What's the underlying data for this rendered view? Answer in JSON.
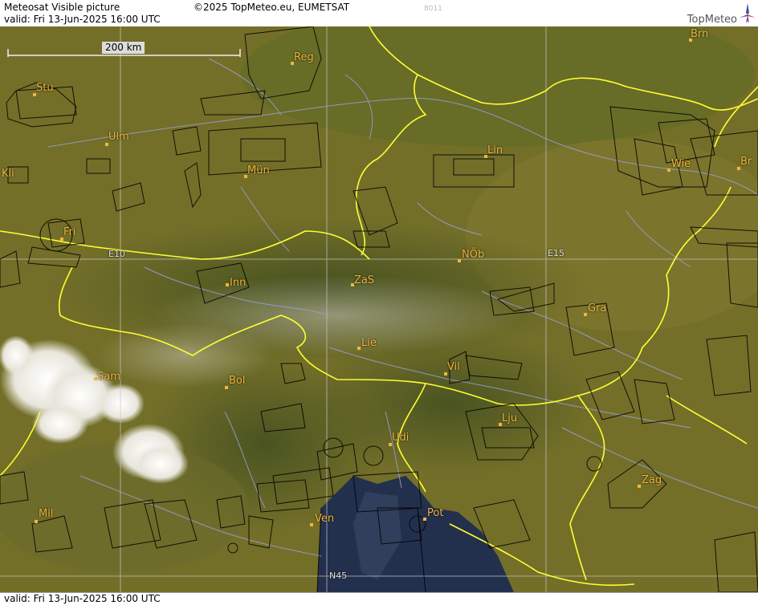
{
  "header": {
    "title": "Meteosat Visible picture",
    "copyright": "©2025 TopMeteo.eu, EUMETSAT",
    "code": "8011",
    "valid": "valid:  Fri  13-Jun-2025  16:00 UTC",
    "brand": "TopMeteo"
  },
  "footer": {
    "valid": "valid:  Fri  13-Jun-2025  16:00 UTC"
  },
  "scale": {
    "label": "200 km"
  },
  "grid_labels": {
    "e10": "E10",
    "e15": "E15",
    "n45": "N45"
  },
  "cities": [
    {
      "name": "Brn"
    },
    {
      "name": "Reg"
    },
    {
      "name": "Stu"
    },
    {
      "name": "Ulm"
    },
    {
      "name": "Lin"
    },
    {
      "name": "Wie"
    },
    {
      "name": "Br"
    },
    {
      "name": "Kli"
    },
    {
      "name": "Mün"
    },
    {
      "name": "Fri"
    },
    {
      "name": "NÖb"
    },
    {
      "name": "Inn"
    },
    {
      "name": "ZaS"
    },
    {
      "name": "Gra"
    },
    {
      "name": "Lie"
    },
    {
      "name": "Vil"
    },
    {
      "name": "Sam"
    },
    {
      "name": "Bol"
    },
    {
      "name": "Lju"
    },
    {
      "name": "Udi"
    },
    {
      "name": "Zag"
    },
    {
      "name": "Mil"
    },
    {
      "name": "Ven"
    },
    {
      "name": "Pot"
    }
  ],
  "colors": {
    "city": "#f0b63a",
    "border": "#ffff33",
    "terrain": "#6d6a26",
    "sea": "#2a3a5a"
  }
}
